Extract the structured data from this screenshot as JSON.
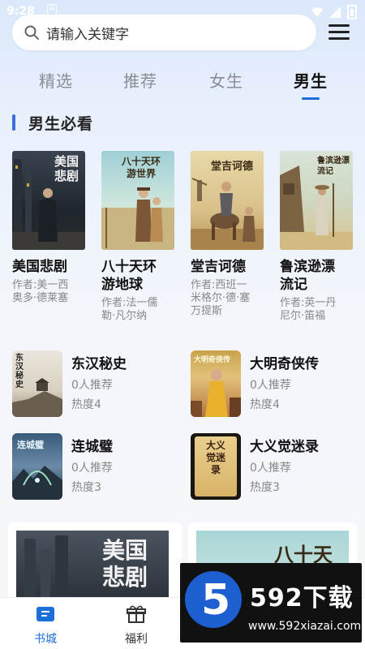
{
  "status_bar": {
    "time": "9:28",
    "notif": "A"
  },
  "search": {
    "placeholder": "请输入关键字"
  },
  "tabs": [
    {
      "label": "精选"
    },
    {
      "label": "推荐"
    },
    {
      "label": "女生"
    },
    {
      "label": "男生",
      "active": true
    }
  ],
  "section": {
    "title": "男生必看"
  },
  "featured_books": [
    {
      "title_line1": "美国悲剧",
      "title_line2": "",
      "author_line1": "作者:美一西",
      "author_line2": "奥多·德莱塞",
      "cover_text": "美国悲剧"
    },
    {
      "title_line1": "八十天环",
      "title_line2": "游地球",
      "author_line1": "作者:法一儒",
      "author_line2": "勒·凡尔纳",
      "cover_text": "八十天环游世界"
    },
    {
      "title_line1": "堂吉诃德",
      "title_line2": "",
      "author_line1": "作者:西班一",
      "author_line2": "米格尔·德·塞",
      "author_line3": "万提斯",
      "cover_text": "堂吉诃德"
    },
    {
      "title_line1": "鲁滨逊漂",
      "title_line2": "流记",
      "author_line1": "作者:英一丹",
      "author_line2": "尼尔·笛福",
      "cover_text": "鲁滨逊漂流记"
    }
  ],
  "list_books": [
    {
      "title": "东汉秘史",
      "recommend": "0人推荐",
      "heat": "热度4",
      "cover_text": "东汉秘史"
    },
    {
      "title": "大明奇侠传",
      "recommend": "0人推荐",
      "heat": "热度4",
      "cover_text": "大明奇侠传"
    },
    {
      "title": "连城璧",
      "recommend": "0人推荐",
      "heat": "热度3",
      "cover_text": "连城璧"
    },
    {
      "title": "大义觉迷录",
      "recommend": "0人推荐",
      "heat": "热度3",
      "cover_text": "大义觉迷录"
    }
  ],
  "banners": [
    {
      "cover_text": "美国悲剧"
    },
    {
      "cover_text": "八十天"
    }
  ],
  "bottom_nav": [
    {
      "label": "书城",
      "active": true
    },
    {
      "label": "福利"
    }
  ],
  "watermark": {
    "brand": "592下载",
    "url": "www.592xiazai.com"
  },
  "colors": {
    "accent": "#1b6fd8",
    "section_bar": "#3b6fe0",
    "muted": "#888888"
  }
}
